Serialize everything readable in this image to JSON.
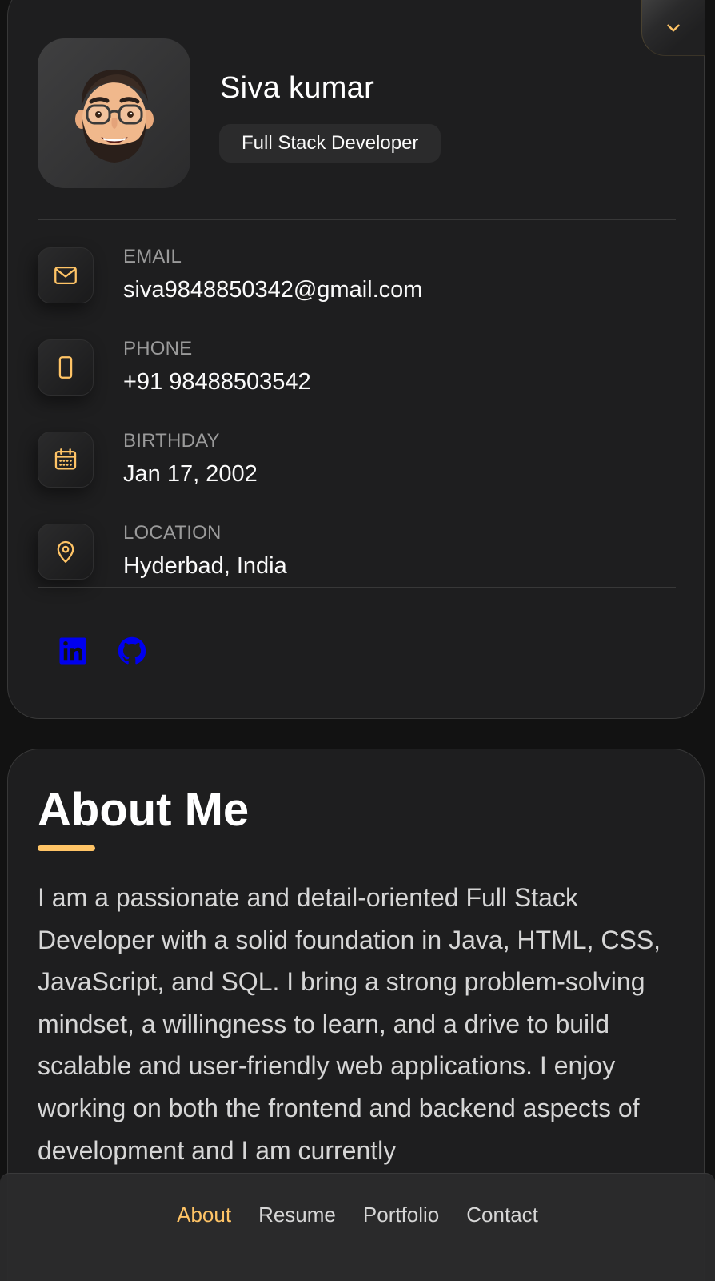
{
  "profile": {
    "name": "Siva kumar",
    "title": "Full Stack Developer",
    "avatar_icon": "memoji-avatar"
  },
  "contacts": [
    {
      "label": "Email",
      "value": "siva9848850342@gmail.com",
      "icon": "mail-icon"
    },
    {
      "label": "Phone",
      "value": "+91 98488503542",
      "icon": "phone-icon"
    },
    {
      "label": "Birthday",
      "value": "Jan 17, 2002",
      "icon": "calendar-icon"
    },
    {
      "label": "Location",
      "value": "Hyderbad, India",
      "icon": "location-icon"
    }
  ],
  "social": [
    "linkedin-icon",
    "github-icon"
  ],
  "about": {
    "title": "About Me",
    "text": "I am a passionate and detail-oriented Full Stack Developer with a solid foundation in Java, HTML, CSS, JavaScript, and SQL. I bring a strong problem-solving mindset, a willingness to learn, and a drive to build scalable and user-friendly web applications. I enjoy working on both the frontend and backend aspects of development and I am currently"
  },
  "nav": [
    {
      "label": "About",
      "active": true
    },
    {
      "label": "Resume",
      "active": false
    },
    {
      "label": "Portfolio",
      "active": false
    },
    {
      "label": "Contact",
      "active": false
    }
  ],
  "colors": {
    "accent": "#ffc466",
    "background": "#121212",
    "card": "#1e1e1f",
    "social_link": "#0000ee"
  }
}
